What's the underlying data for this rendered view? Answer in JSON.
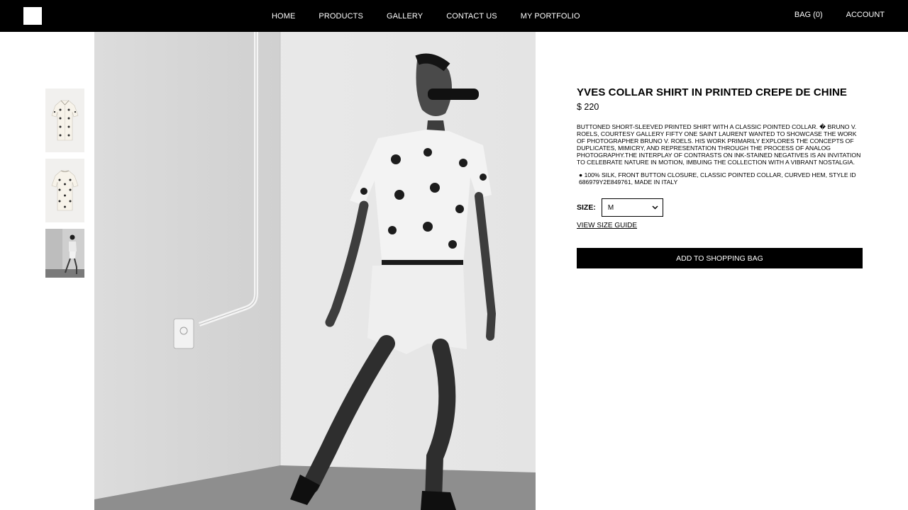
{
  "nav": {
    "items": [
      "HOME",
      "PRODUCTS",
      "GALLERY",
      "CONTACT US",
      "MY PORTFOLIO"
    ],
    "bag_label": "BAG (0)",
    "account_label": "ACCOUNT"
  },
  "product": {
    "title": "YVES COLLAR SHIRT IN PRINTED CREPE DE CHINE",
    "price": "$ 220",
    "description": "BUTTONED SHORT-SLEEVED PRINTED SHIRT WITH A CLASSIC POINTED COLLAR. � BRUNO V. ROELS, COURTESY GALLERY FIFTY ONE SAINT LAURENT WANTED TO SHOWCASE THE WORK OF PHOTOGRAPHER BRUNO V. ROELS. HIS WORK PRIMARILY EXPLORES THE CONCEPTS OF DUPLICATES, MIMICRY, AND REPRESENTATION THROUGH THE PROCESS OF ANALOG PHOTOGRAPHY.THE INTERPLAY OF CONTRASTS ON INK-STAINED NEGATIVES IS AN INVITATION TO CELEBRATE NATURE IN MOTION, IMBUING THE COLLECTION WITH A VIBRANT NOSTALGIA.",
    "details": "● 100% SILK, FRONT BUTTON CLOSURE, CLASSIC POINTED COLLAR, CURVED HEM, STYLE ID 686979Y2E849761, MADE IN ITALY",
    "size_label": "SIZE:",
    "size_selected": "M",
    "size_guide_label": "VIEW SIZE GUIDE",
    "add_to_bag_label": "ADD TO SHOPPING BAG"
  },
  "gallery": {
    "thumbnails": [
      "shirt-front",
      "shirt-back",
      "model-full-body"
    ],
    "main_image": "model-wearing-shirt"
  },
  "colors": {
    "header_bg": "#000000",
    "header_text": "#ffffff",
    "button_bg": "#000000",
    "page_bg": "#ffffff"
  },
  "icons": [
    "logo-square-icon",
    "chevron-down-icon"
  ]
}
